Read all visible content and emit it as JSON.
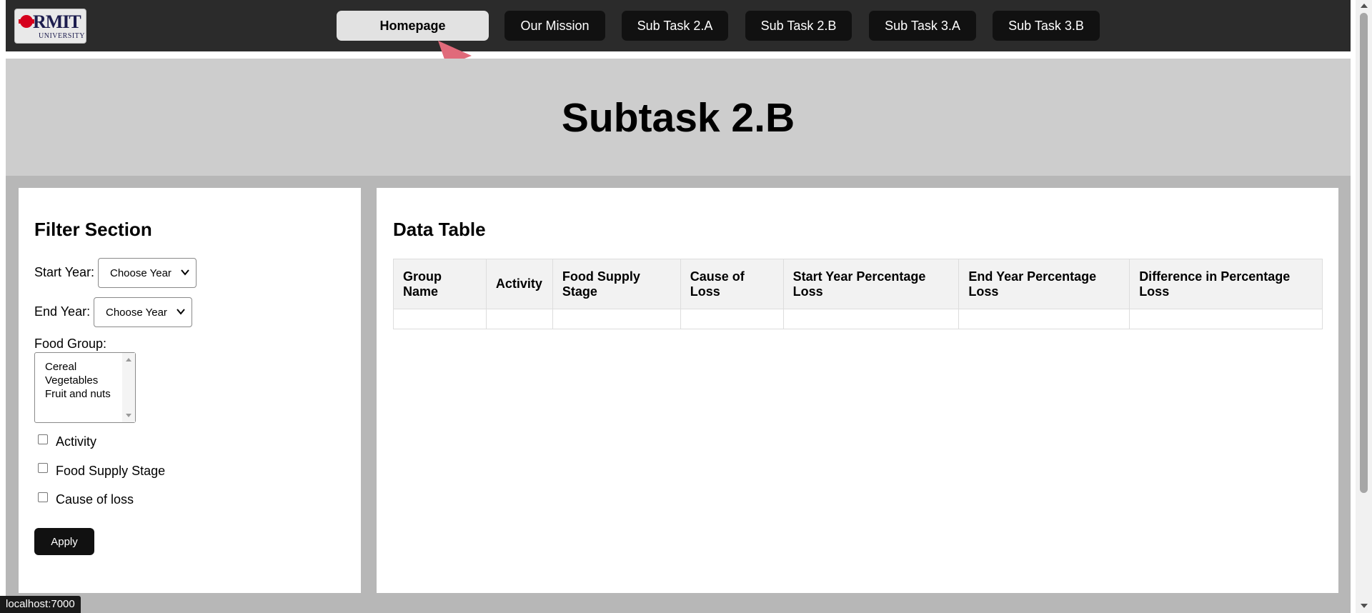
{
  "nav": {
    "logo": {
      "name": "RMIT",
      "sub": "UNIVERSITY"
    },
    "items": [
      {
        "label": "Homepage",
        "active": true
      },
      {
        "label": "Our Mission"
      },
      {
        "label": "Sub Task 2.A"
      },
      {
        "label": "Sub Task 2.B"
      },
      {
        "label": "Sub Task 3.A"
      },
      {
        "label": "Sub Task 3.B"
      }
    ]
  },
  "page_title": "Subtask 2.B",
  "filter": {
    "title": "Filter Section",
    "start_year_label": "Start Year:",
    "start_year_value": "Choose Year",
    "end_year_label": "End Year:",
    "end_year_value": "Choose Year",
    "food_group_label": "Food Group:",
    "food_groups": [
      "Cereal",
      "Vegetables",
      "Fruit and nuts"
    ],
    "checkboxes": [
      {
        "label": "Activity",
        "checked": false
      },
      {
        "label": "Food Supply Stage",
        "checked": false
      },
      {
        "label": "Cause of loss",
        "checked": false
      }
    ],
    "apply_label": "Apply"
  },
  "table": {
    "title": "Data Table",
    "headers": [
      [
        "Group",
        "Name"
      ],
      [
        "Activity"
      ],
      [
        "Food Supply",
        "Stage"
      ],
      [
        "Cause of",
        "Loss"
      ],
      [
        "Start Year Percentage",
        "Loss"
      ],
      [
        "End Year Percentage",
        "Loss"
      ],
      [
        "Difference in Percentage",
        "Loss"
      ]
    ],
    "rows": [
      [
        "",
        "",
        "",
        "",
        "",
        "",
        ""
      ]
    ]
  },
  "status_bar": "localhost:7000",
  "colors": {
    "navbar": "#2b2b2b",
    "hero": "#cdcdcd",
    "band": "#b7b7b7",
    "cursor": "#e06a7a"
  },
  "icons": [
    "rmit-logo-icon",
    "cursor-arrow-icon",
    "chevron-down-icon",
    "scroll-up-icon",
    "scroll-down-icon"
  ]
}
